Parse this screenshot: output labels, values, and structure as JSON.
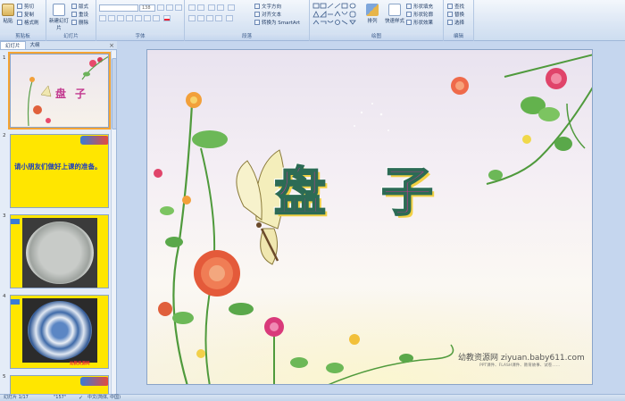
{
  "ribbon": {
    "clipboard": {
      "paste": "粘贴",
      "cut": "剪切",
      "copy": "复制",
      "format_painter": "格式刷",
      "label": "剪贴板"
    },
    "slides": {
      "new_slide": "新建幻灯片",
      "layout": "版式",
      "reset": "重设",
      "delete": "删除",
      "label": "幻灯片"
    },
    "font": {
      "font_size": "138",
      "label": "字体"
    },
    "paragraph": {
      "text_direction": "文字方向",
      "align_text": "对齐文本",
      "smartart": "转换为 SmartArt",
      "label": "段落"
    },
    "drawing": {
      "arrange": "排列",
      "quick_styles": "快速样式",
      "shape_fill": "形状填充",
      "shape_outline": "形状轮廓",
      "shape_effects": "形状效果",
      "label": "绘图"
    },
    "editing": {
      "find": "查找",
      "replace": "替换",
      "select": "选择",
      "label": "编辑"
    }
  },
  "panel": {
    "tabs": [
      "幻灯片",
      "大纲"
    ],
    "thumb2_text": "请小朋友们做好上课的准备。",
    "thumb4_logo": "幼教资源网",
    "slide_numbers": [
      "1",
      "2",
      "3",
      "4",
      "5"
    ]
  },
  "slide": {
    "title": "盘子",
    "watermark": "幼教资源网 ziyuan.baby611.com",
    "watermark_sub": "PPT课件、FLASH课件、教育故事、试卷……"
  },
  "status": {
    "slide_info": "幻灯片 1/17",
    "theme": "\"157\"",
    "language": "中文(简体, 中国)"
  },
  "colors": {
    "accent": "#f5a433",
    "ribbon": "#dbe6f4",
    "thumb_yellow": "#ffe600"
  }
}
